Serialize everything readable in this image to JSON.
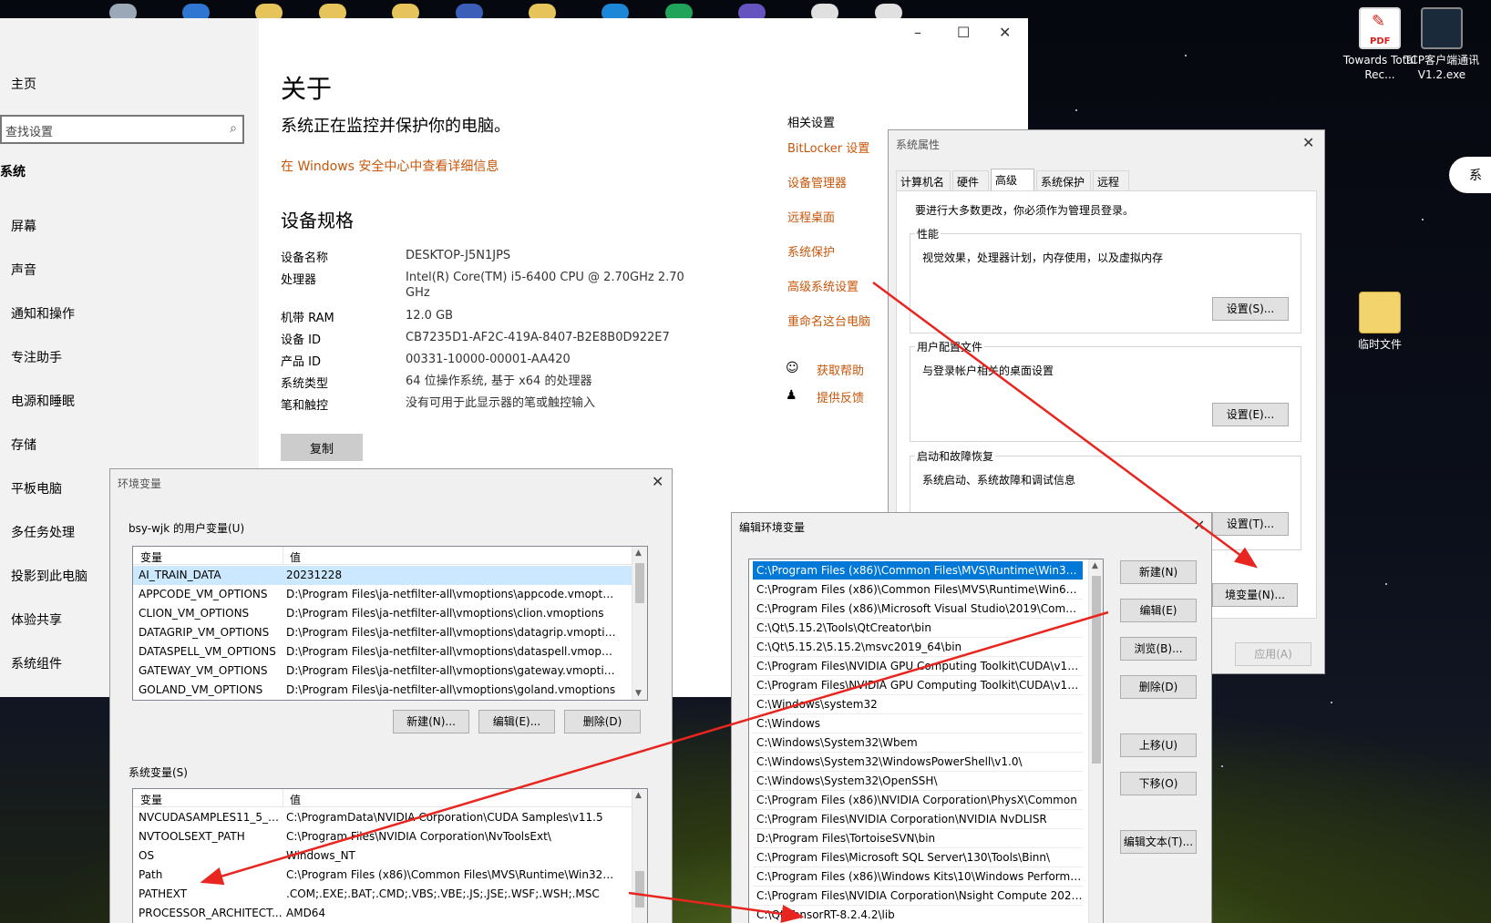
{
  "desktop": {
    "icons": [
      {
        "label": "Towards Total Rec...",
        "type": "pdf"
      },
      {
        "label": "TCP客户端通讯V1.2.exe",
        "type": "exe"
      },
      {
        "label": "临时文件",
        "type": "folder"
      }
    ],
    "pdf_badge": "PDF",
    "partial_right_text": "系"
  },
  "settings": {
    "sidebar": {
      "home": "主页",
      "search_placeholder": "查找设置",
      "section": "系统",
      "items": [
        "屏幕",
        "声音",
        "通知和操作",
        "专注助手",
        "电源和睡眠",
        "存储",
        "平板电脑",
        "多任务处理",
        "投影到此电脑",
        "体验共享",
        "系统组件"
      ]
    },
    "title": "关于",
    "subtitle": "系统正在监控并保护你的电脑。",
    "security_link": "在 Windows 安全中心中查看详细信息",
    "device_spec_title": "设备规格",
    "specs": [
      {
        "label": "设备名称",
        "value": "DESKTOP-J5N1JPS"
      },
      {
        "label": "处理器",
        "value": "Intel(R) Core(TM) i5-6400 CPU @ 2.70GHz   2.70 GHz"
      },
      {
        "label": "机带 RAM",
        "value": "12.0 GB"
      },
      {
        "label": "设备 ID",
        "value": "CB7235D1-AF2C-419A-8407-B2E8B0D922E7"
      },
      {
        "label": "产品 ID",
        "value": "00331-10000-00001-AA420"
      },
      {
        "label": "系统类型",
        "value": "64 位操作系统, 基于 x64 的处理器"
      },
      {
        "label": "笔和触控",
        "value": "没有可用于此显示器的笔或触控输入"
      }
    ],
    "copy_button": "复制",
    "related": {
      "title": "相关设置",
      "links": [
        "BitLocker 设置",
        "设备管理器",
        "远程桌面",
        "系统保护",
        "高级系统设置",
        "重命名这台电脑"
      ],
      "help": "获取帮助",
      "feedback": "提供反馈"
    }
  },
  "sysprops": {
    "title": "系统属性",
    "tabs": [
      "计算机名",
      "硬件",
      "高级",
      "系统保护",
      "远程"
    ],
    "active_tab": "高级",
    "admin_note": "要进行大多数更改，你必须作为管理员登录。",
    "performance": {
      "label": "性能",
      "desc": "视觉效果，处理器计划，内存使用，以及虚拟内存",
      "button": "设置(S)..."
    },
    "profile": {
      "label": "用户配置文件",
      "desc": "与登录帐户相关的桌面设置",
      "button": "设置(E)..."
    },
    "startup": {
      "label": "启动和故障恢复",
      "desc": "系统启动、系统故障和调试信息",
      "button": "设置(T)..."
    },
    "env_button": "境变量(N)...",
    "apply_button": "应用(A)"
  },
  "envvars": {
    "title": "环境变量",
    "user_label": "bsy-wjk 的用户变量(U)",
    "col_var": "变量",
    "col_val": "值",
    "user_vars": [
      {
        "name": "AI_TRAIN_DATA",
        "value": "20231228"
      },
      {
        "name": "APPCODE_VM_OPTIONS",
        "value": "D:\\Program Files\\ja-netfilter-all\\vmoptions\\appcode.vmoptions"
      },
      {
        "name": "CLION_VM_OPTIONS",
        "value": "D:\\Program Files\\ja-netfilter-all\\vmoptions\\clion.vmoptions"
      },
      {
        "name": "DATAGRIP_VM_OPTIONS",
        "value": "D:\\Program Files\\ja-netfilter-all\\vmoptions\\datagrip.vmoptions"
      },
      {
        "name": "DATASPELL_VM_OPTIONS",
        "value": "D:\\Program Files\\ja-netfilter-all\\vmoptions\\dataspell.vmoptio..."
      },
      {
        "name": "GATEWAY_VM_OPTIONS",
        "value": "D:\\Program Files\\ja-netfilter-all\\vmoptions\\gateway.vmoptions"
      },
      {
        "name": "GOLAND_VM_OPTIONS",
        "value": "D:\\Program Files\\ja-netfilter-all\\vmoptions\\goland.vmoptions"
      }
    ],
    "user_buttons": [
      "新建(N)...",
      "编辑(E)...",
      "删除(D)"
    ],
    "sys_label": "系统变量(S)",
    "sys_vars": [
      {
        "name": "NVCUDASAMPLES11_5_R...",
        "value": "C:\\ProgramData\\NVIDIA Corporation\\CUDA Samples\\v11.5"
      },
      {
        "name": "NVTOOLSEXT_PATH",
        "value": "C:\\Program Files\\NVIDIA Corporation\\NvToolsExt\\"
      },
      {
        "name": "OS",
        "value": "Windows_NT"
      },
      {
        "name": "Path",
        "value": "C:\\Program Files (x86)\\Common Files\\MVS\\Runtime\\Win32_i8..."
      },
      {
        "name": "PATHEXT",
        "value": ".COM;.EXE;.BAT;.CMD;.VBS;.VBE;.JS;.JSE;.WSF;.WSH;.MSC"
      },
      {
        "name": "PROCESSOR_ARCHITECT...",
        "value": "AMD64"
      }
    ]
  },
  "editenv": {
    "title": "编辑环境变量",
    "paths": [
      "C:\\Program Files (x86)\\Common Files\\MVS\\Runtime\\Win32_i86",
      "C:\\Program Files (x86)\\Common Files\\MVS\\Runtime\\Win64_x...",
      "C:\\Program Files (x86)\\Microsoft Visual Studio\\2019\\Commu...",
      "C:\\Qt\\5.15.2\\Tools\\QtCreator\\bin",
      "C:\\Qt\\5.15.2\\5.15.2\\msvc2019_64\\bin",
      "C:\\Program Files\\NVIDIA GPU Computing Toolkit\\CUDA\\v11....",
      "C:\\Program Files\\NVIDIA GPU Computing Toolkit\\CUDA\\v11....",
      "C:\\Windows\\system32",
      "C:\\Windows",
      "C:\\Windows\\System32\\Wbem",
      "C:\\Windows\\System32\\WindowsPowerShell\\v1.0\\",
      "C:\\Windows\\System32\\OpenSSH\\",
      "C:\\Program Files (x86)\\NVIDIA Corporation\\PhysX\\Common",
      "C:\\Program Files\\NVIDIA Corporation\\NVIDIA NvDLISR",
      "D:\\Program Files\\TortoiseSVN\\bin",
      "C:\\Program Files\\Microsoft SQL Server\\130\\Tools\\Binn\\",
      "C:\\Program Files (x86)\\Windows Kits\\10\\Windows Performan...",
      "C:\\Program Files\\NVIDIA Corporation\\Nsight Compute 2021....",
      "C:\\Qt\\TensorRT-8.2.4.2\\lib"
    ],
    "buttons": [
      "新建(N)",
      "编辑(E)",
      "浏览(B)...",
      "删除(D)",
      "上移(U)",
      "下移(O)",
      "编辑文本(T)..."
    ]
  },
  "colors": {
    "accent_orange": "#c7560a",
    "selection": "#0078d7",
    "arrow": "#e8261f"
  }
}
